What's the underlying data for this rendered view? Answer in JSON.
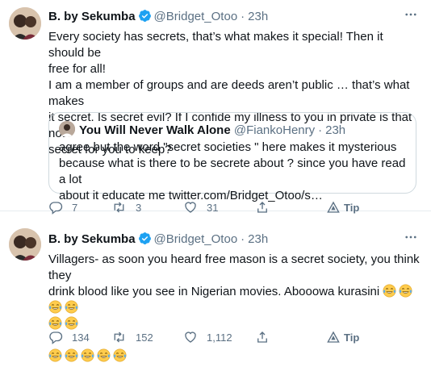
{
  "tweets": [
    {
      "author": {
        "name": "B. by Sekumba",
        "handle": "@Bridget_Otoo"
      },
      "separator": "·",
      "time": "23h",
      "text_lines": [
        "Every society has secrets, that’s what makes it special! Then it should be",
        "free for all!",
        "I am a member of groups and are deeds aren’t public … that’s what makes",
        "it secret. Is secret evil? If I confide my illness to you in private is that not",
        "secret for you to keep?"
      ],
      "quote": {
        "author": {
          "name": "You Will Never Walk Alone",
          "handle": "@FiankoHenry"
        },
        "separator": "·",
        "time": "23h",
        "text_lines": [
          "agree but the  word \"secret societies \" here makes it mysterious",
          "because what is there to be secrete about ? since you have read a lot",
          "about it educate me twitter.com/Bridget_Otoo/s…"
        ]
      },
      "actions": {
        "replies": "7",
        "retweets": "3",
        "likes": "31",
        "tip": "Tip"
      }
    },
    {
      "author": {
        "name": "B. by Sekumba",
        "handle": "@Bridget_Otoo"
      },
      "separator": "·",
      "time": "23h",
      "text_lines": [
        "Villagers- as soon you heard free mason is a secret society, you think they",
        "drink blood like you see in Nigerian movies. Abooowa kurasini"
      ],
      "emoji_lines": {
        "line2_count": 4,
        "line3_count": 2,
        "line5_count": 5
      },
      "actions": {
        "replies": "134",
        "retweets": "152",
        "likes": "1,112",
        "tip": "Tip"
      }
    }
  ],
  "colors": {
    "verified": "#1da1f2",
    "muted": "#5b7083",
    "text": "#0f1419",
    "border": "#cfd9de"
  },
  "icons": [
    "verified-badge-icon",
    "more-icon",
    "reply-icon",
    "retweet-icon",
    "like-icon",
    "share-icon",
    "tip-icon",
    "tears-of-joy-emoji"
  ]
}
